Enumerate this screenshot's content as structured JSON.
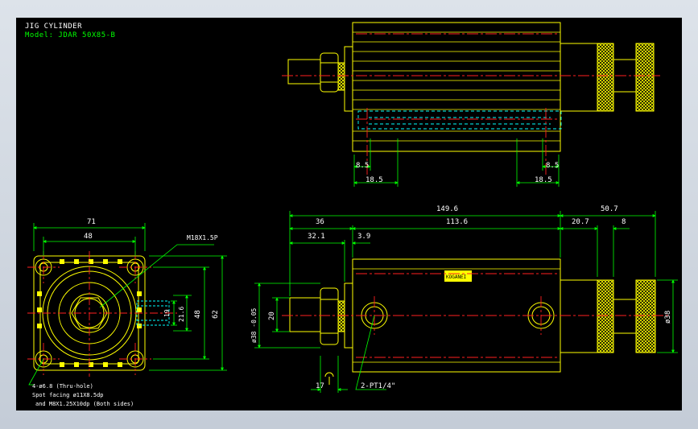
{
  "header": {
    "title": "JIG CYLINDER",
    "model": "Model: JDAR 50X85-B"
  },
  "end_view": {
    "dims": {
      "width_71": "71",
      "pitch_48": "48",
      "v48": "48",
      "v62": "62",
      "d19": "19",
      "d216": "21.6"
    },
    "thread": "M18X1.5P",
    "hole_note": {
      "line1": "4-ø6.8 (Thru-hole)",
      "line2": "Spot facing ø11X8.5dp",
      "line3": "and M8X1.25X10dp (Both sides)"
    }
  },
  "top_view": {
    "dims": {
      "a": "8.5",
      "b": "18.5",
      "c": "8.5",
      "d": "18.5"
    }
  },
  "side_view": {
    "dims": {
      "overall": "149.6",
      "rod": "50.7",
      "d36": "36",
      "d1136": "113.6",
      "d207": "20.7",
      "d8": "8",
      "d321": "32.1",
      "d39": "3.9",
      "d20": "20",
      "rod_dia": "ø38 -0.05",
      "d38": "ø38",
      "d17": "17",
      "port": "2-PT1/4\""
    },
    "label_plate": "KOGANEI"
  },
  "colors": {
    "background": "#000000",
    "geometry": "#ffff00",
    "dimension": "#00ff00",
    "centerline": "#ff2020",
    "hidden": "#00ffff",
    "white": "#ffffff"
  }
}
